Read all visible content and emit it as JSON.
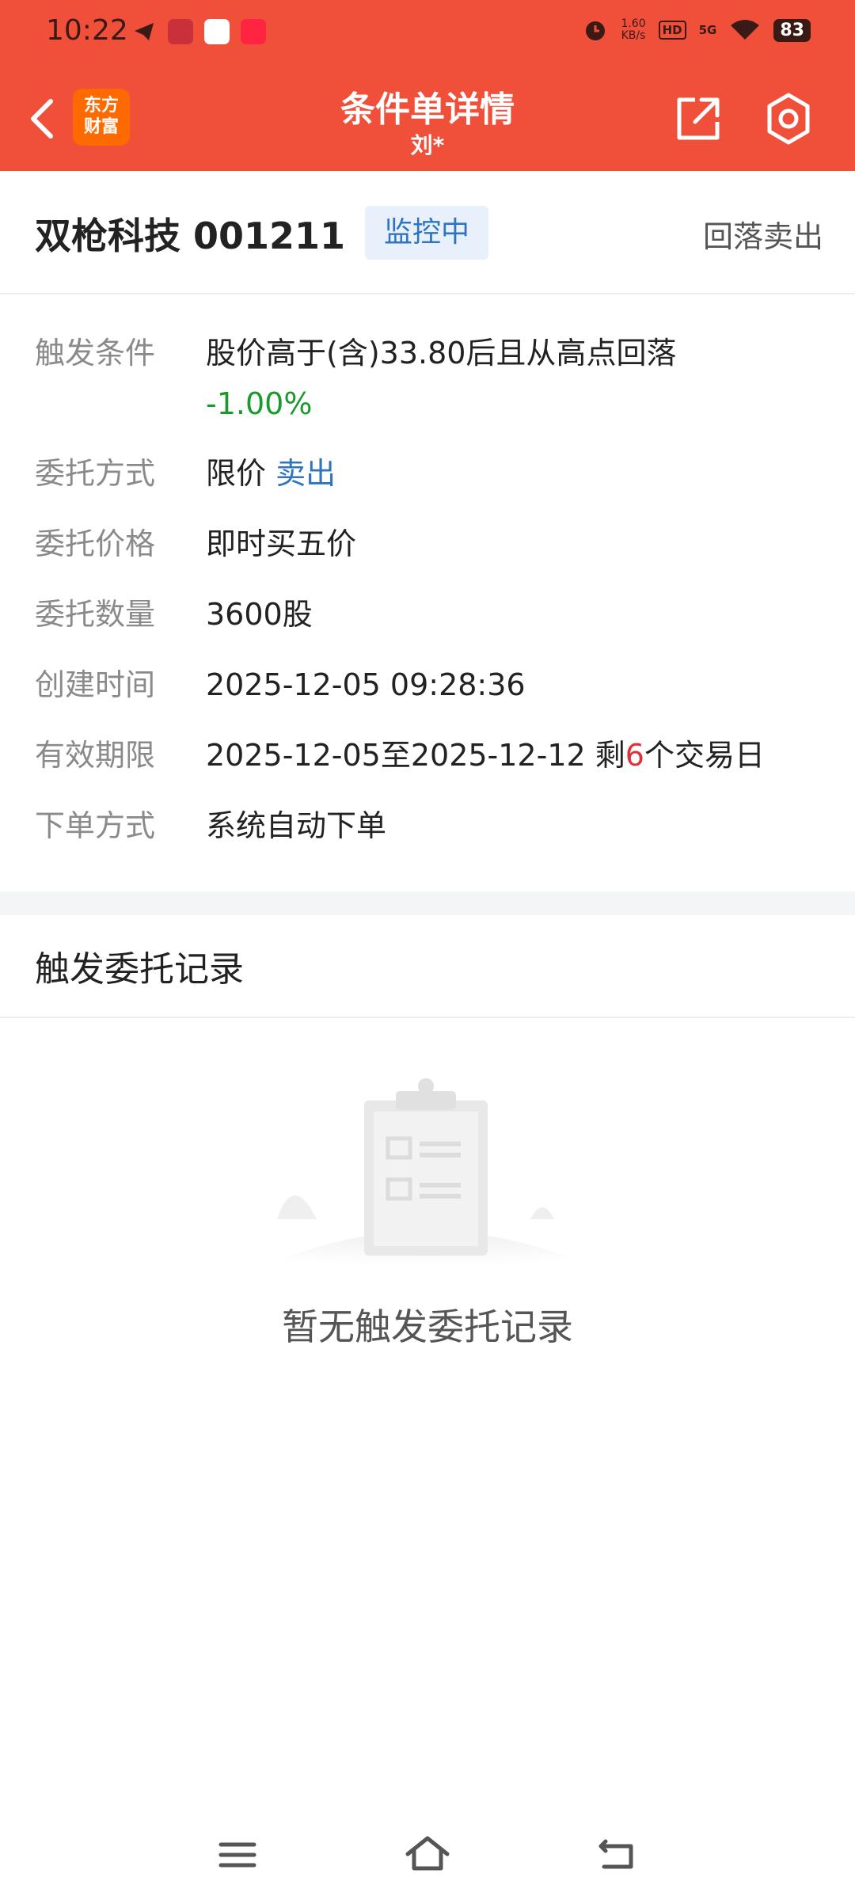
{
  "status_bar": {
    "time": "10:22",
    "net_speed_value": "1.60",
    "net_speed_unit": "KB/s",
    "hd": "HD",
    "network": "5G",
    "battery": "83"
  },
  "header": {
    "logo_line1": "东方",
    "logo_line2": "财富",
    "title": "条件单详情",
    "subtitle": "刘*"
  },
  "stock": {
    "name": "双枪科技 001211",
    "status": "监控中",
    "order_type": "回落卖出"
  },
  "details": {
    "trigger_label": "触发条件",
    "trigger_value": "股价高于(含)33.80后且从高点回落",
    "trigger_pct": "-1.00%",
    "method_label": "委托方式",
    "method_value": "限价",
    "method_direction": "卖出",
    "price_label": "委托价格",
    "price_value": "即时买五价",
    "qty_label": "委托数量",
    "qty_value": "3600股",
    "created_label": "创建时间",
    "created_value": "2025-12-05 09:28:36",
    "valid_label": "有效期限",
    "valid_range": "2025-12-05至2025-12-12 剩",
    "valid_days": "6",
    "valid_suffix": "个交易日",
    "placement_label": "下单方式",
    "placement_value": "系统自动下单"
  },
  "records": {
    "title": "触发委托记录",
    "empty_text": "暂无触发委托记录"
  },
  "colors": {
    "header_bg": "#f0503a",
    "accent_blue": "#2f74c0",
    "green": "#1a9a2c",
    "red": "#e0313a"
  }
}
